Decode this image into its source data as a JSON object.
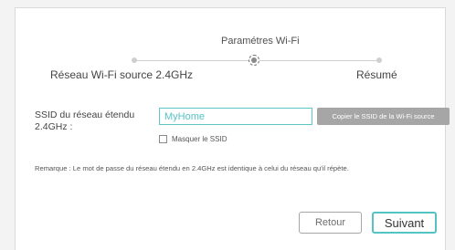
{
  "wizard": {
    "step_title": "Paramétres Wi-Fi",
    "steps": [
      {
        "label": "Réseau Wi-Fi source 2.4GHz"
      },
      {
        "label": "Paramétres Wi-Fi"
      },
      {
        "label": "Résumé"
      }
    ],
    "current_step": 2
  },
  "form": {
    "ssid_label": "SSID du réseau étendu 2.4GHz :",
    "ssid_value": "MyHome",
    "copy_button": "Copier le SSID  de la Wi-Fi source",
    "hide_ssid_label": "Masquer le SSID",
    "hide_ssid_checked": false
  },
  "remark": "Remarque : Le mot de passe du réseau étendu en 2.4GHz est identique à celui du  réseau qu'il répète.",
  "actions": {
    "back": "Retour",
    "next": "Suivant"
  },
  "colors": {
    "accent": "#53c3c4",
    "button_disabled": "#a6a6a6"
  }
}
